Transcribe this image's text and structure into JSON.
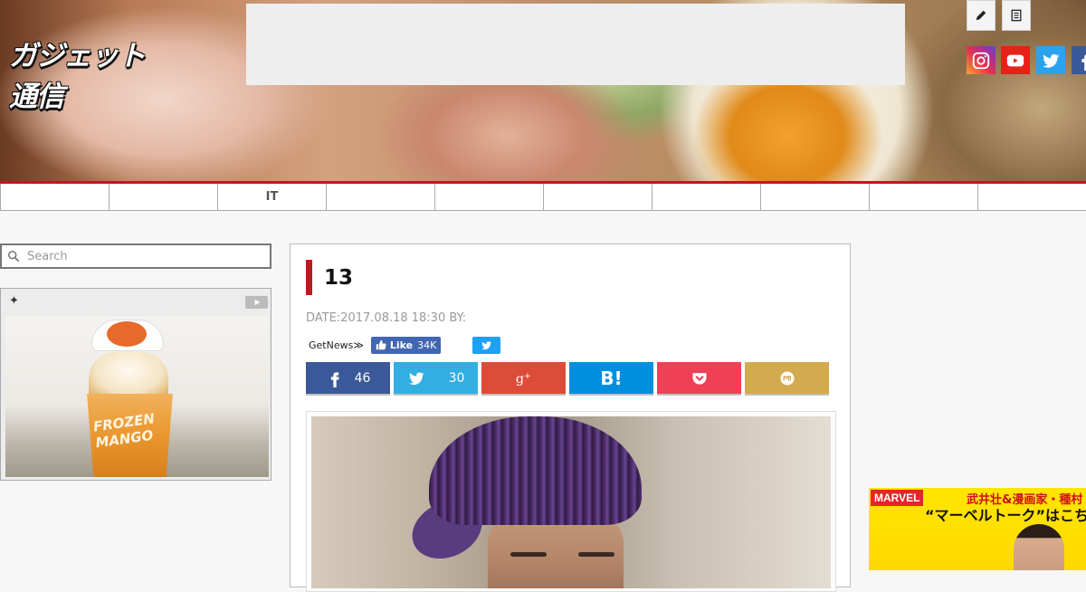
{
  "header": {
    "logo_text": "ガジェット通信",
    "icons": {
      "edit": "pencil-icon",
      "list": "document-icon"
    },
    "social": [
      "instagram-icon",
      "youtube-icon",
      "twitter-icon",
      "facebook-icon"
    ]
  },
  "nav": {
    "items": [
      "",
      "",
      "IT",
      "",
      "",
      "",
      "",
      "",
      "",
      ""
    ]
  },
  "sidebar": {
    "search_placeholder": "Search",
    "ad_tag": "✦",
    "ad_image_text": "FROZEN MANGO"
  },
  "article": {
    "title": "13",
    "meta": "DATE:2017.08.18 18:30 BY:",
    "getnews": "GetNews≫",
    "fb_like_label": "Like",
    "fb_like_count": "34K",
    "share": {
      "facebook_count": "46",
      "twitter_count": "30",
      "hatena_label": "B!"
    }
  },
  "right_ad": {
    "brand": "MARVEL",
    "line1": "武井壮&漫画家・種村",
    "line2": "“マーベルトーク”はこち"
  },
  "colors": {
    "accent": "#c41620",
    "facebook": "#3b5998",
    "twitter": "#33aee1",
    "googleplus": "#dd4b39",
    "hatena": "#008fde",
    "pocket": "#ef4056",
    "mixi": "#d4aa4f"
  }
}
